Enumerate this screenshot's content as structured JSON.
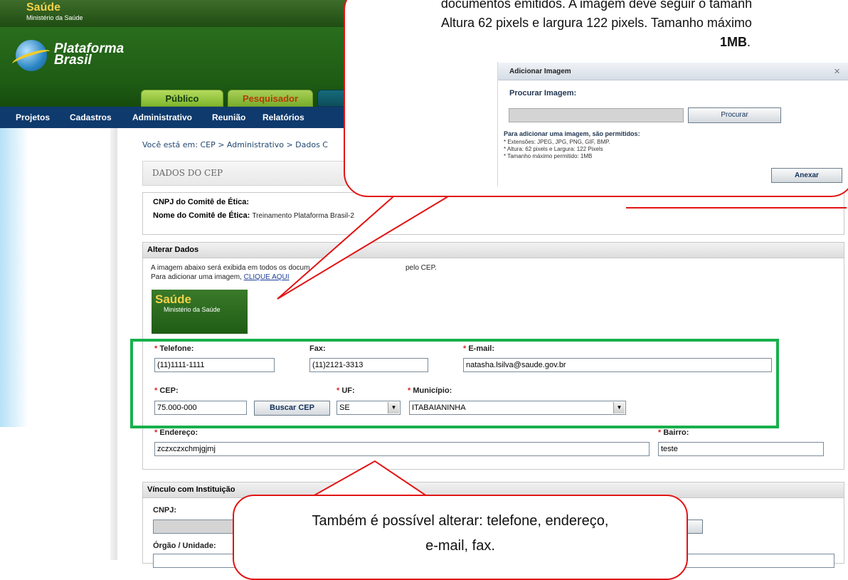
{
  "header": {
    "brand_title": "Saúde",
    "brand_sub": "Ministério da Saúde",
    "logo_line1": "Plataforma",
    "logo_line2": "Brasil",
    "tabs": [
      {
        "label": "Público"
      },
      {
        "label": "Pesquisador"
      }
    ],
    "nav": [
      "Projetos",
      "Cadastros",
      "Administrativo",
      "Reunião",
      "Relatórios"
    ]
  },
  "breadcrumb": "Você está em: CEP > Administrativo > Dados C",
  "section_title": "DADOS DO CEP",
  "identity": {
    "cnpj_label": "CNPJ do Comitê de Ética:",
    "name_label": "Nome do Comitê de Ética:",
    "name_value": "Treinamento Plataforma Brasil-2"
  },
  "alterar": {
    "title": "Alterar Dados",
    "line1": "A imagem abaixo será exibida em todos os docum",
    "line1_end": "pelo CEP.",
    "line2_prefix": "Para adicionar uma imagem,",
    "line2_link": "CLIQUE AQUI",
    "preview_title": "Saúde",
    "preview_sub": "Ministério da Saúde"
  },
  "form": {
    "required_mark": "*",
    "telefone_label": "Telefone:",
    "telefone_value": "(11)1111-1111",
    "fax_label": "Fax:",
    "fax_value": "(11)2121-3313",
    "email_label": "E-mail:",
    "email_value": "natasha.lsilva@saude.gov.br",
    "cep_label": "CEP:",
    "cep_value": "75.000-000",
    "buscar_cep": "Buscar CEP",
    "uf_label": "UF:",
    "uf_value": "SE",
    "municipio_label": "Município:",
    "municipio_value": "ITABAIANINHA",
    "endereco_label": "Endereço:",
    "endereco_value": "zczxczxchmjgjmj",
    "bairro_label": "Bairro:",
    "bairro_value": "teste"
  },
  "vinculo": {
    "title": "Vínculo com Instituição",
    "cnpj_label": "CNPJ:",
    "orgao_label": "Órgão / Unidade:"
  },
  "callout_top": {
    "line1": "documentos emitidos. A imagem deve seguir o tamanh",
    "line2": "Altura 62 pixels e largura 122 pixels. Tamanho máximo",
    "line3": "1MB",
    "line3_end": "."
  },
  "dialog": {
    "title": "Adicionar Imagem",
    "close": "✕",
    "procurar_label": "Procurar Imagem:",
    "procurar_button": "Procurar",
    "rules_title": "Para adicionar uma imagem, são permitidos:",
    "rule1": "* Extensões: JPEG, JPG, PNG, GIF, BMP.",
    "rule2": "* Altura: 62 pixels e Largura: 122 Pixels",
    "rule3": "* Tamanho máximo permitido: 1MB",
    "anexar_button": "Anexar"
  },
  "callout_bottom": {
    "line1": "Também é possível alterar: telefone, endereço,",
    "line2": "e-mail, fax."
  },
  "colors": {
    "header_green": "#1e5c14",
    "nav_blue": "#0f3a6d",
    "callout_red": "#e21414",
    "highlight_green": "#18b04c"
  }
}
